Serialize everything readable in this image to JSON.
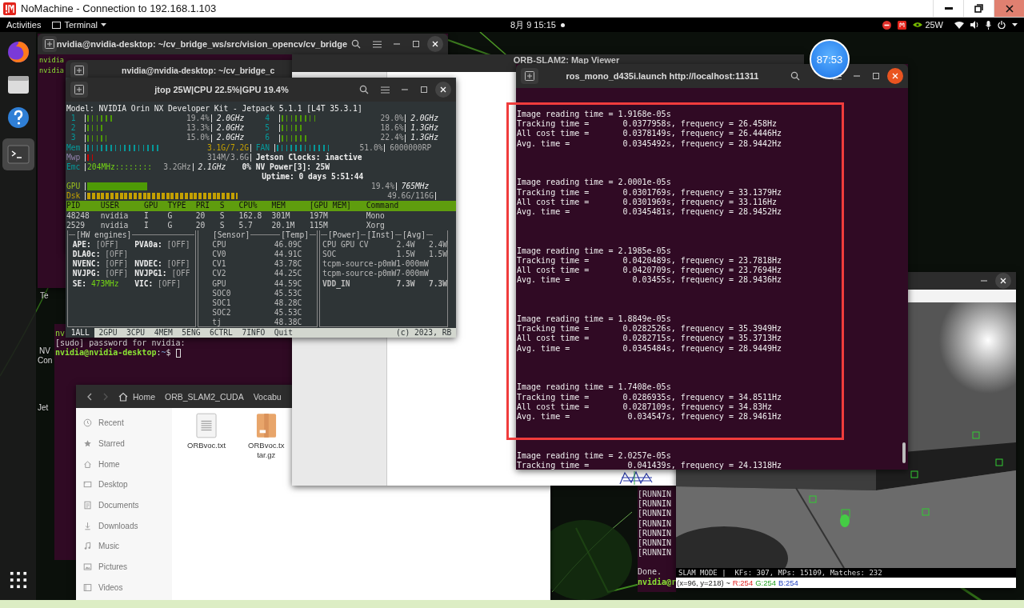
{
  "nomachine": {
    "title": "NoMachine - Connection to 192.168.1.103"
  },
  "topbar": {
    "activities": "Activities",
    "app_menu": "Terminal",
    "clock": "8月 9 15:15",
    "power_mode": "25W"
  },
  "desktop_icons": [
    "Te",
    "NV",
    "Con",
    "Jet"
  ],
  "terminal_back": {
    "title": "nvidia@nvidia-desktop: ~/cv_bridge_ws/src/vision_opencv/cv_bridge",
    "top_lines": [
      "nvidia",
      "nvidia"
    ],
    "bottom_lines": [
      "nv",
      "[sudo] password for nvidia:"
    ],
    "prompt": {
      "user": "nvidia@nvidia-desktop",
      "sep": ":",
      "path": "~",
      "sign": "$"
    }
  },
  "terminal_front": {
    "title": "nvidia@nvidia-desktop: ~/cv_bridge_c"
  },
  "map_viewer": {
    "title": "ORB-SLAM2: Map Viewer"
  },
  "jtop": {
    "title": "jtop 25W|CPU 22.5%|GPU 19.4%",
    "model": "Model: NVIDIA Orin NX Developer Kit - Jetpack 5.1.1 [L4T 35.3.1]",
    "cpus": [
      {
        "id": "1",
        "level": 0.194,
        "reading": "19.4%",
        "freq": "2.0GHz"
      },
      {
        "id": "4",
        "level": 0.29,
        "reading": "29.0%",
        "freq": "2.0GHz"
      },
      {
        "id": "2",
        "level": 0.133,
        "reading": "13.3%",
        "freq": "2.0GHz"
      },
      {
        "id": "5",
        "level": 0.186,
        "reading": "18.6%",
        "freq": "1.3GHz"
      },
      {
        "id": "3",
        "level": 0.15,
        "reading": "15.0%",
        "freq": "2.0GHz"
      },
      {
        "id": "6",
        "level": 0.224,
        "reading": "22.4%",
        "freq": "1.3GHz"
      }
    ],
    "mem": {
      "label": "Mem",
      "level": 0.43,
      "reading": "3.1G/7.2G"
    },
    "fan": {
      "label": "FAN",
      "level": 0.51,
      "reading": "51.0%",
      "speed": "6000000RP"
    },
    "swap": {
      "label": "Mwp",
      "level": 0.06,
      "reading": "314M/3.6G"
    },
    "jetson_clocks": "Jetson Clocks: inactive",
    "emc": {
      "label": "Emc",
      "bar": "204MHz::::::::",
      "reading": "3.2GHz",
      "freq": "2.1GHz",
      "load": "0%"
    },
    "nv_power": "NV Power[3]: 25W",
    "uptime": "Uptime: 0 days 5:51:44",
    "gpu": {
      "label": "GPU",
      "level": 0.194,
      "reading": "19.4%",
      "freq": "765MHz"
    },
    "disk": {
      "label": "Dsk",
      "level": 0.43,
      "reading": "49.6G/116G"
    },
    "process_columns": [
      "PID",
      "USER",
      "GPU",
      "TYPE",
      "PRI",
      "S",
      "CPU%",
      "MEM",
      "[GPU MEM]",
      "Command"
    ],
    "processes": [
      [
        "48248",
        "nvidia",
        "I",
        "G",
        "20",
        "S",
        "162.8",
        "301M",
        "197M",
        "Mono"
      ],
      [
        "2529",
        "nvidia",
        "I",
        "G",
        "20",
        "S",
        "5.7",
        "20.1M",
        "115M",
        "Xorg"
      ]
    ],
    "hw_title": "[HW engines]",
    "hw_engines": [
      {
        "name": "APE:",
        "state": "[OFF]",
        "on": false
      },
      {
        "name": "PVA0a:",
        "state": "[OFF]",
        "on": false
      },
      {
        "name": "DLA0c:",
        "state": "[OFF]",
        "on": false
      },
      {
        "name": "NVENC:",
        "state": "[OFF]",
        "on": false
      },
      {
        "name": "NVDEC:",
        "state": "[OFF]",
        "on": false
      },
      {
        "name": "NVJPG:",
        "state": "[OFF]",
        "on": false
      },
      {
        "name": "NVJPG1:",
        "state": "[OFF",
        "on": false
      },
      {
        "name": "SE:",
        "state": "473MHz",
        "on": true
      },
      {
        "name": "VIC:",
        "state": "[OFF]",
        "on": false
      }
    ],
    "sensor_headers": [
      "[Sensor]",
      "[Temp]"
    ],
    "sensors": [
      [
        "CPU",
        "46.09C"
      ],
      [
        "CV0",
        "44.91C"
      ],
      [
        "CV1",
        "43.78C"
      ],
      [
        "CV2",
        "44.25C"
      ],
      [
        "GPU",
        "44.59C"
      ],
      [
        "SOC0",
        "45.53C"
      ],
      [
        "SOC1",
        "48.28C"
      ],
      [
        "SOC2",
        "45.53C"
      ],
      [
        "tj",
        "48.38C"
      ]
    ],
    "power_headers": [
      "[Power]",
      "[Inst]",
      "[Avg]"
    ],
    "power": [
      {
        "name": "CPU GPU CV",
        "inst": "2.4W",
        "avg": "2.4W",
        "total": false
      },
      {
        "name": "SOC",
        "inst": "1.5W",
        "avg": "1.5W",
        "total": false
      },
      {
        "name": "tcpm-source-p0mW1-000mW",
        "total": false
      },
      {
        "name": "tcpm-source-p0mW7-000mW",
        "total": false
      },
      {
        "name": "VDD_IN",
        "inst": "7.3W",
        "avg": "7.3W",
        "total": true
      }
    ],
    "tabs": [
      {
        "label": "1ALL",
        "selected": true
      },
      {
        "label": "2GPU",
        "selected": false
      },
      {
        "label": "3CPU",
        "selected": false
      },
      {
        "label": "4MEM",
        "selected": false
      },
      {
        "label": "5ENG",
        "selected": false
      },
      {
        "label": "6CTRL",
        "selected": false
      },
      {
        "label": "7INFO",
        "selected": false
      },
      {
        "label": "Quit",
        "selected": false
      }
    ],
    "copyright": "(c) 2023, RB"
  },
  "timer": "87:53",
  "ros_terminal": {
    "title": "ros_mono_d435i.launch http://localhost:11311",
    "blocks": [
      [
        "Image reading time = 1.9168e-05s",
        "Tracking time =       0.0377958s, frequency = 26.458Hz",
        "All cost time =       0.0378149s, frequency = 26.4446Hz",
        "Avg. time =           0.0345492s, frequency = 28.9442Hz"
      ],
      [
        "Image reading time = 2.0001e-05s",
        "Tracking time =       0.0301769s, frequency = 33.1379Hz",
        "All cost time =       0.0301969s, frequency = 33.116Hz",
        "Avg. time =           0.0345481s, frequency = 28.9452Hz"
      ],
      [
        "Image reading time = 2.1985e-05s",
        "Tracking time =       0.0420489s, frequency = 23.7818Hz",
        "All cost time =       0.0420709s, frequency = 23.7694Hz",
        "Avg. time =             0.03455s, frequency = 28.9436Hz"
      ],
      [
        "Image reading time = 1.8849e-05s",
        "Tracking time =       0.0282526s, frequency = 35.3949Hz",
        "All cost time =       0.0282715s, frequency = 35.3713Hz",
        "Avg. time =           0.0345484s, frequency = 28.9449Hz"
      ],
      [
        "Image reading time = 1.7408e-05s",
        "Tracking time =       0.0286935s, frequency = 34.8511Hz",
        "All cost time =       0.0287109s, frequency = 34.83Hz",
        "Avg. time =            0.034547s, frequency = 28.9461Hz"
      ],
      [
        "Image reading time = 2.0257e-05s",
        "Tracking time =        0.041439s, frequency = 24.1318Hz"
      ]
    ]
  },
  "launch_terminal": {
    "lines": [
      "[RUNNIN",
      "[RUNNIN",
      "[RUNNIN",
      "[RUNNIN",
      "[RUNNIN",
      "[RUNNIN",
      "[RUNNIN"
    ],
    "done": "Done.",
    "prompt": "nvidia@r"
  },
  "camera": {
    "status": "SLAM MODE |  KFs: 307, MPs: 15109, Matches: 232",
    "coords": "(x=96, y=218) ~",
    "r": "R:254",
    "g": "G:254",
    "b": "B:254"
  },
  "files": {
    "path": [
      {
        "label": "Home",
        "kind": "home"
      },
      {
        "label": "ORB_SLAM2_CUDA",
        "kind": "folder"
      },
      {
        "label": "Vocabu",
        "kind": "folder"
      }
    ],
    "places": [
      {
        "label": "Recent",
        "kind": "recent"
      },
      {
        "label": "Starred",
        "kind": "starred"
      },
      {
        "label": "Home",
        "kind": "home"
      },
      {
        "label": "Desktop",
        "kind": "desktop"
      },
      {
        "label": "Documents",
        "kind": "documents"
      },
      {
        "label": "Downloads",
        "kind": "downloads"
      },
      {
        "label": "Music",
        "kind": "music"
      },
      {
        "label": "Pictures",
        "kind": "pictures"
      },
      {
        "label": "Videos",
        "kind": "videos"
      }
    ],
    "items": [
      {
        "name_lines": [
          "ORBvoc.txt"
        ],
        "kind": "text"
      },
      {
        "name_lines": [
          "ORBvoc.tx",
          "tar.gz"
        ],
        "kind": "archive"
      }
    ]
  }
}
